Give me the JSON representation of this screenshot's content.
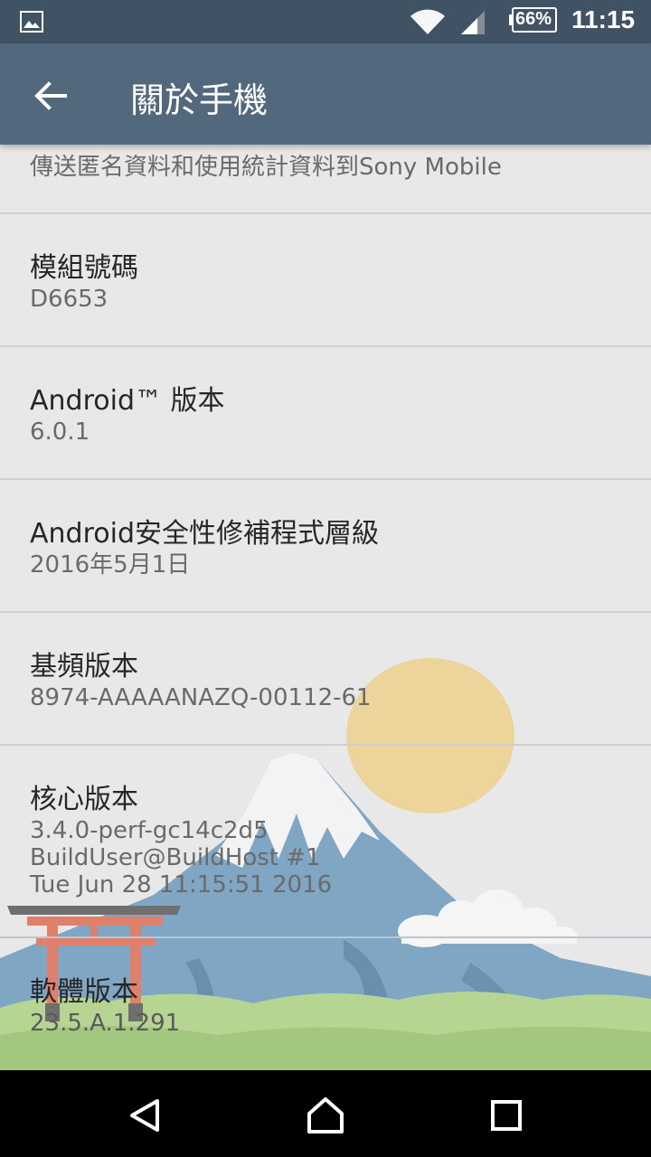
{
  "status_bar": {
    "battery": "66%",
    "time": "11:15"
  },
  "app_bar": {
    "title": "關於手機"
  },
  "items": [
    {
      "subtitle": "傳送匿名資料和使用統計資料到Sony Mobile"
    },
    {
      "title": "模組號碼",
      "subtitle": "D6653"
    },
    {
      "title": "Android™ 版本",
      "subtitle": "6.0.1"
    },
    {
      "title": "Android安全性修補程式層級",
      "subtitle": "2016年5月1日"
    },
    {
      "title": "基頻版本",
      "subtitle": "8974-AAAAANAZQ-00112-61"
    },
    {
      "title": "核心版本",
      "subtitle_lines": [
        "3.4.0-perf-gc14c2d5",
        "BuildUser@BuildHost #1",
        "Tue Jun 28 11:15:51 2016"
      ]
    },
    {
      "title": "軟體版本",
      "subtitle": "23.5.A.1.291"
    }
  ],
  "nav": {
    "icons": [
      "back-icon",
      "home-icon",
      "recents-icon"
    ]
  },
  "colors": {
    "status_bar": "#3f5365",
    "app_bar": "#52687c",
    "background": "#e8e8e8",
    "sun": "#ecd49a",
    "mountain": "#7fa6c2",
    "grass": "#a9cc86"
  }
}
